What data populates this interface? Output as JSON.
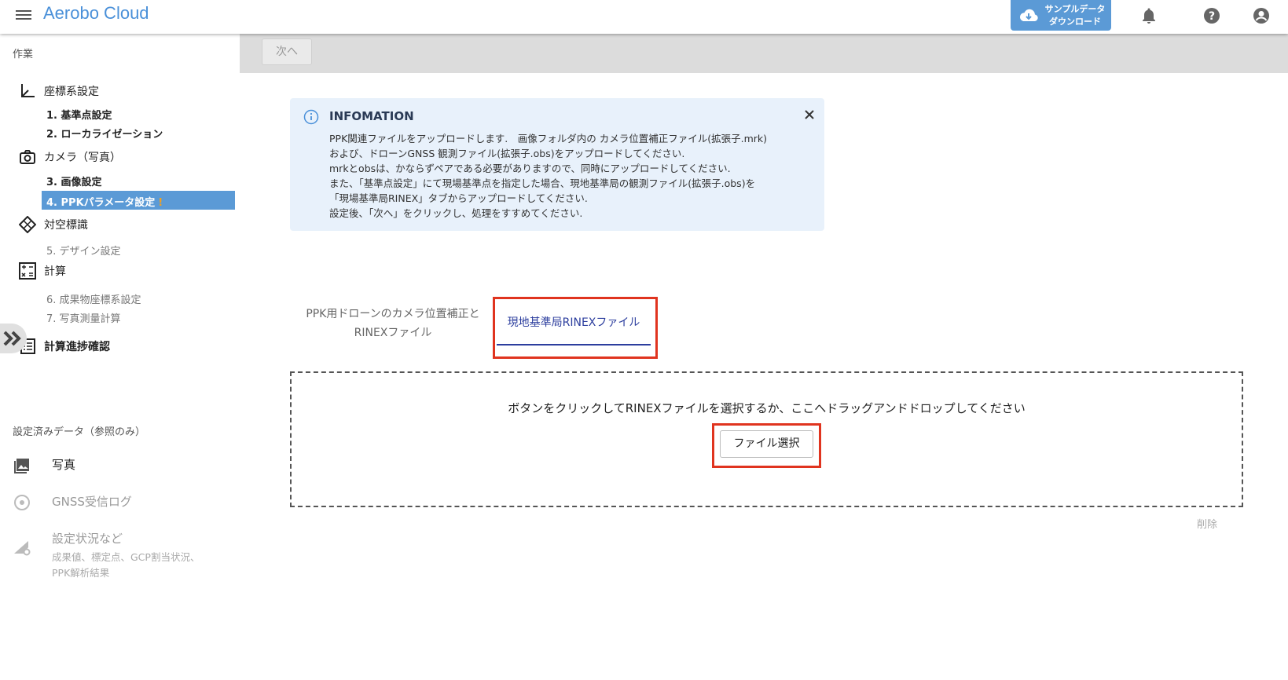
{
  "header": {
    "app_title": "Aerobo Cloud",
    "sample_download_line1": "サンプルデータ",
    "sample_download_line2": "ダウンロード",
    "icons": [
      "menu-icon",
      "cloud-download-icon",
      "bell-icon",
      "help-icon",
      "account-icon"
    ],
    "accent_color": "#4a90d9"
  },
  "sidebar": {
    "work_title": "作業",
    "groups": [
      {
        "label": "座標系設定",
        "icon": "axis-icon",
        "steps": [
          "1. 基準点設定",
          "2. ローカライゼーション"
        ]
      },
      {
        "label": "カメラ（写真）",
        "icon": "camera-icon",
        "steps": [
          "3. 画像設定",
          "4. PPKパラメータ設定"
        ]
      },
      {
        "label": "対空標識",
        "icon": "target-diamond-icon",
        "steps": [
          "5. デザイン設定"
        ]
      },
      {
        "label": "計算",
        "icon": "calculator-icon",
        "steps": [
          "6. 成果物座標系設定",
          "7. 写真測量計算"
        ]
      },
      {
        "label": "計算進捗確認",
        "icon": "list-icon",
        "steps": []
      }
    ],
    "active_step_warning": "!",
    "reference_title": "設定済みデータ（参照のみ）",
    "reference_items": [
      {
        "label": "写真",
        "icon": "photo-icon"
      },
      {
        "label": "GNSS受信ログ",
        "icon": "gnss-icon"
      },
      {
        "label": "設定状況など",
        "sub1": "成果値、標定点、GCP割当状況、",
        "sub2": "PPK解析結果",
        "icon": "settings-chart-icon"
      }
    ]
  },
  "main": {
    "next_label": "次へ",
    "info": {
      "title": "INFOMATION",
      "lines": [
        "PPK関連ファイルをアップロードします.　画像フォルダ内の カメラ位置補正ファイル(拡張子.mrk)",
        "および、ドローンGNSS 観測ファイル(拡張子.obs)をアップロードしてください.",
        "mrkとobsは、かならずペアである必要がありますので、同時にアップロードしてください.",
        "また、「基準点設定」にて現場基準点を指定した場合、現地基準局の観測ファイル(拡張子.obs)を",
        "「現場基準局RINEX」タブからアップロードしてください.",
        "設定後、「次へ」をクリックし、処理をすすめてください."
      ]
    },
    "tabs": {
      "tab1_line1": "PPK用ドローンのカメラ位置補正と",
      "tab1_line2": "RINEXファイル",
      "tab2": "現地基準局RINEXファイル"
    },
    "dropzone_text": "ボタンをクリックしてRINEXファイルを選択するか、ここへドラッグアンドドロップしてください",
    "file_select_label": "ファイル選択",
    "delete_label": "削除"
  }
}
